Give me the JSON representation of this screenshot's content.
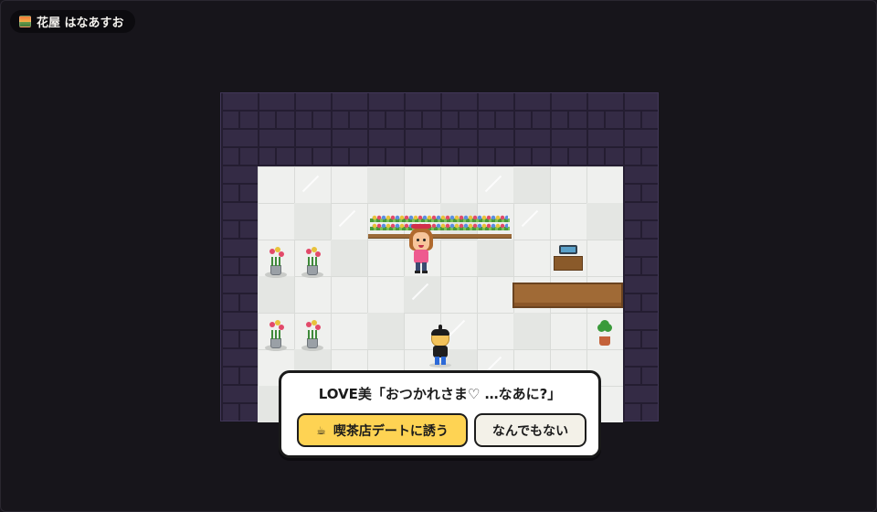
{
  "hud": {
    "location_name": "花屋 はなあすお",
    "location_icon": "sunset-image-icon"
  },
  "scene": {
    "npc_name": "LOVE美",
    "wall_color": "#342b45",
    "floor_color": "#eff0ee"
  },
  "dialog": {
    "speaker_line": "LOVE美「おつかれさま♡ …なあに?」",
    "choices": [
      {
        "icon": "coffee-cup-icon",
        "icon_glyph": "☕",
        "label": "喫茶店デートに誘う",
        "color": "#fed353"
      },
      {
        "label": "なんでもない",
        "color": "#f3f1e8"
      }
    ]
  }
}
